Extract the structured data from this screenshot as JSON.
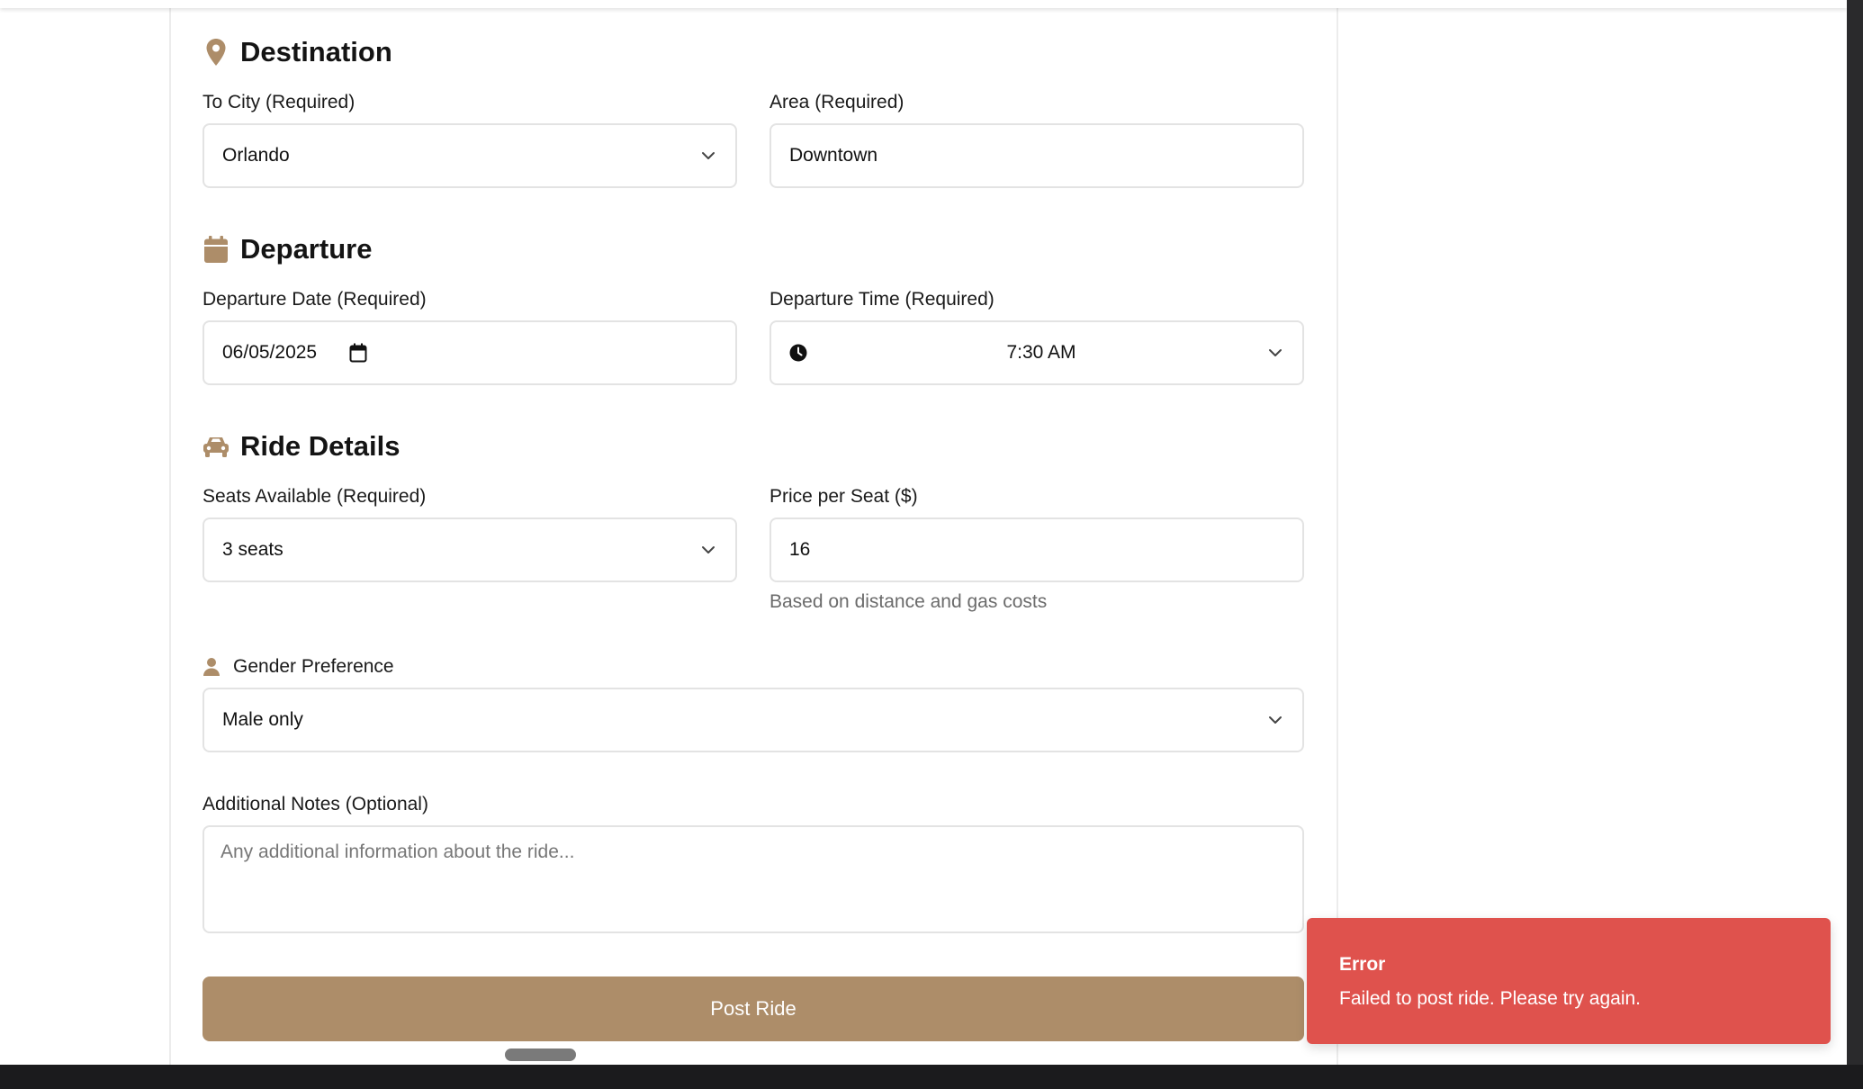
{
  "colors": {
    "accent": "#ad8d69",
    "error": "#df524d",
    "border": "#e3e3e3",
    "hint": "#6b6b6b"
  },
  "destination": {
    "title": "Destination",
    "icon": "map-pin-icon",
    "to_city_label": "To City (Required)",
    "to_city_value": "Orlando",
    "area_label": "Area (Required)",
    "area_value": "Downtown"
  },
  "departure": {
    "title": "Departure",
    "icon": "calendar-icon",
    "date_label": "Departure Date (Required)",
    "date_value": "06/05/2025",
    "time_label": "Departure Time (Required)",
    "time_value": "7:30 AM"
  },
  "ride_details": {
    "title": "Ride Details",
    "icon": "car-icon",
    "seats_label": "Seats Available (Required)",
    "seats_value": "3 seats",
    "price_label": "Price per Seat ($)",
    "price_value": "16",
    "price_hint": "Based on distance and gas costs"
  },
  "gender": {
    "label": "Gender Preference",
    "icon": "person-icon",
    "value": "Male only"
  },
  "notes": {
    "label": "Additional Notes (Optional)",
    "placeholder": "Any additional information about the ride..."
  },
  "submit": {
    "label": "Post Ride"
  },
  "toast": {
    "title": "Error",
    "message": "Failed to post ride. Please try again."
  }
}
